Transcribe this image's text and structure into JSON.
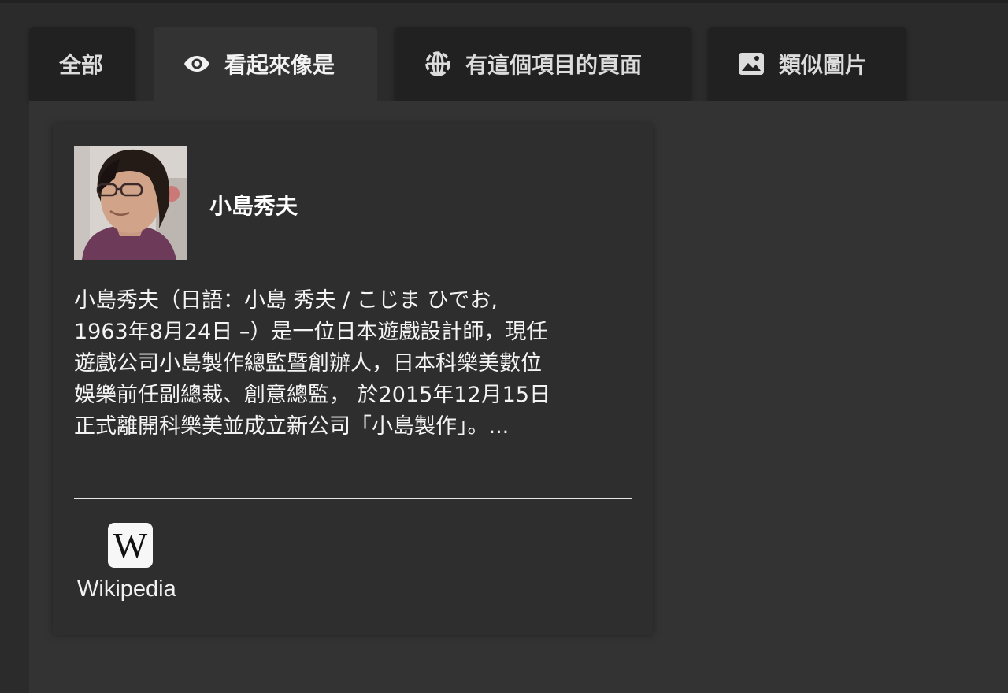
{
  "tabs": [
    {
      "label": "全部",
      "icon": null,
      "active": false
    },
    {
      "label": "看起來像是",
      "icon": "eye-icon",
      "active": true
    },
    {
      "label": "有這個項目的頁面",
      "icon": "globe-dots-icon",
      "active": false
    },
    {
      "label": "類似圖片",
      "icon": "image-icon",
      "active": false
    }
  ],
  "result": {
    "name": "小島秀夫",
    "description_lines": [
      "小島秀夫（日語：小島 秀夫 / こじま ひでお,",
      "1963年8月24日 –）是一位日本遊戲設計師，現任",
      "遊戲公司小島製作總監暨創辦人，日本科樂美數位",
      "娛樂前任副總裁、創意總監， 於2015年12月15日",
      "正式離開科樂美並成立新公司「小島製作」。..."
    ],
    "avatar_icon": "person-photo",
    "source": {
      "label": "Wikipedia",
      "logo_letter": "W",
      "icon": "wikipedia-logo-icon"
    }
  },
  "colors": {
    "background": "#2b2b2b",
    "tab_inactive": "#212121",
    "tab_active": "#333333",
    "panel": "#333333",
    "card": "#2e2e2e",
    "text": "#f4f4f4"
  }
}
